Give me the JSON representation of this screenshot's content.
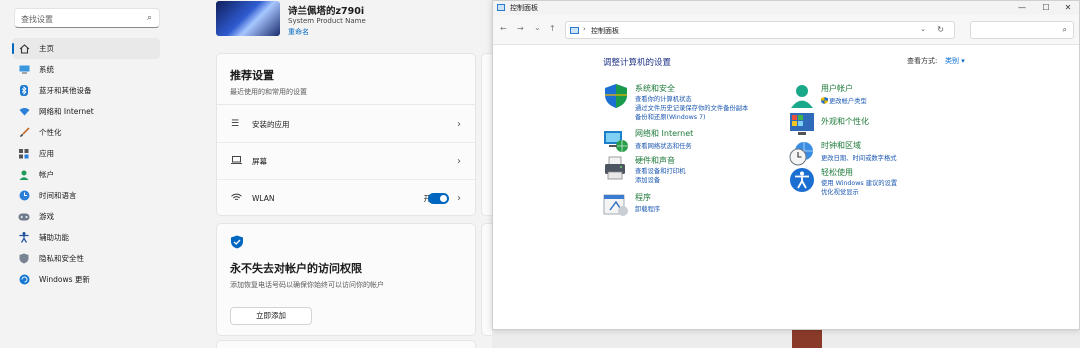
{
  "settings": {
    "search_placeholder": "查找设置",
    "nav": [
      {
        "label": "主页",
        "icon": "home-icon",
        "active": true
      },
      {
        "label": "系统",
        "icon": "monitor-icon"
      },
      {
        "label": "蓝牙和其他设备",
        "icon": "bluetooth-icon"
      },
      {
        "label": "网络和 Internet",
        "icon": "wifi-icon"
      },
      {
        "label": "个性化",
        "icon": "brush-icon"
      },
      {
        "label": "应用",
        "icon": "apps-icon"
      },
      {
        "label": "帐户",
        "icon": "person-icon"
      },
      {
        "label": "时间和语言",
        "icon": "globe-clock-icon"
      },
      {
        "label": "游戏",
        "icon": "gamepad-icon"
      },
      {
        "label": "辅助功能",
        "icon": "accessibility-icon"
      },
      {
        "label": "隐私和安全性",
        "icon": "shield-icon"
      },
      {
        "label": "Windows 更新",
        "icon": "update-icon"
      }
    ],
    "profile": {
      "name": "诗兰佩塔的z790i",
      "model": "System Product Name",
      "rename": "重命名"
    },
    "recommended": {
      "title": "推荐设置",
      "subtitle": "最近使用的和常用的设置",
      "rows": [
        {
          "label": "安装的应用",
          "icon": "list-icon"
        },
        {
          "label": "屏幕",
          "icon": "laptop-icon"
        },
        {
          "label": "WLAN",
          "icon": "wifi-icon",
          "toggle_label": "开",
          "toggle_on": true
        }
      ]
    },
    "security_card": {
      "title": "永不失去对帐户的访问权限",
      "subtitle": "添加恢复电话号码以确保你始终可以访问你的帐户",
      "button": "立即添加"
    }
  },
  "control_panel": {
    "window_title": "控制面板",
    "address_path": "控制面板",
    "heading": "调整计算机的设置",
    "view_by_label": "查看方式:",
    "view_by_value": "类别 ▾",
    "categories_left": [
      {
        "title": "系统和安全",
        "icon": "shield-security-icon",
        "links": [
          "查看你的计算机状态",
          "通过文件历史记录保存你的文件备份副本",
          "备份和还原(Windows 7)"
        ]
      },
      {
        "title": "网络和 Internet",
        "icon": "network-globe-icon",
        "links": [
          "查看网络状态和任务"
        ]
      },
      {
        "title": "硬件和声音",
        "icon": "printer-icon",
        "links": [
          "查看设备和打印机",
          "添加设备"
        ]
      },
      {
        "title": "程序",
        "icon": "programs-icon",
        "links": [
          "卸载程序"
        ]
      }
    ],
    "categories_right": [
      {
        "title": "用户帐户",
        "icon": "users-icon",
        "links": [
          "更改帐户类型"
        ]
      },
      {
        "title": "外观和个性化",
        "icon": "appearance-icon",
        "links": []
      },
      {
        "title": "时钟和区域",
        "icon": "clock-globe-icon",
        "links": [
          "更改日期、时间或数字格式"
        ]
      },
      {
        "title": "轻松使用",
        "icon": "ease-of-access-icon",
        "links": [
          "使用 Windows 建议的设置",
          "优化视觉显示"
        ]
      }
    ]
  },
  "colors": {
    "accent": "#0067c0",
    "cp_link": "#1a57b0",
    "cp_category": "#1e7a3a",
    "cp_heading": "#1e3287"
  }
}
